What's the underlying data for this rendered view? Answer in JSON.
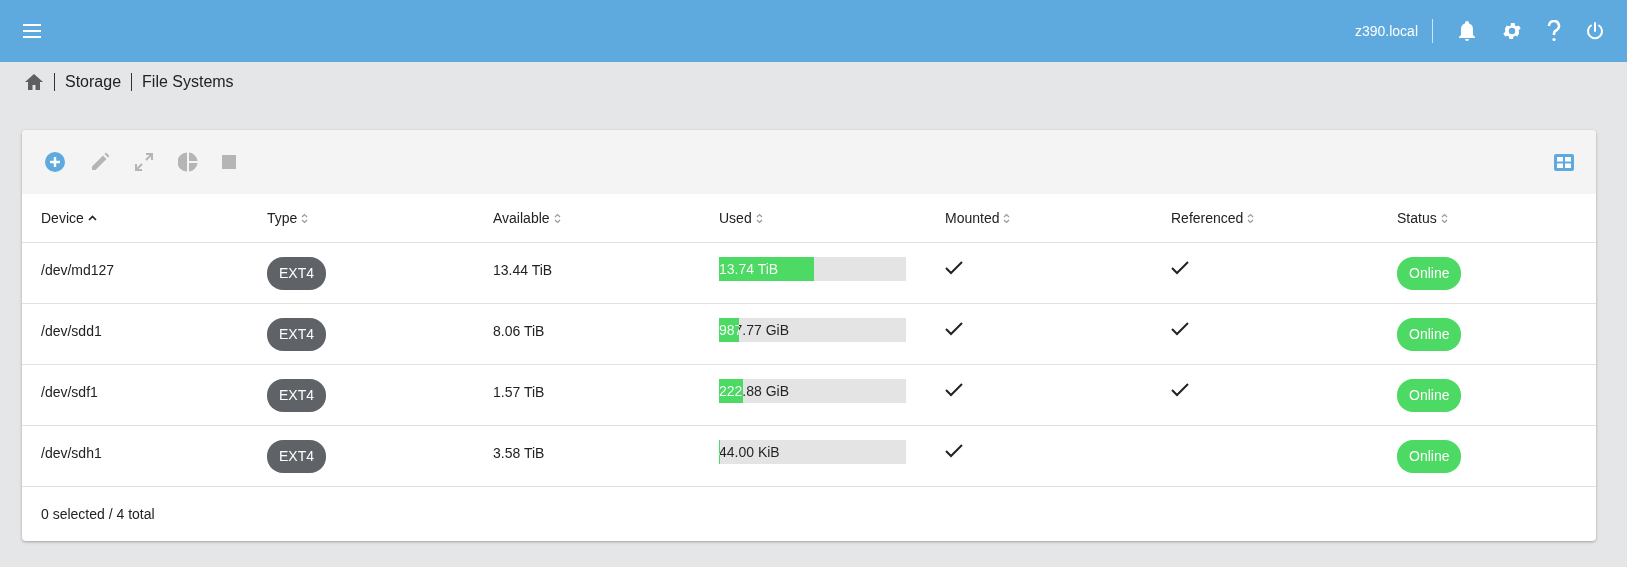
{
  "topbar": {
    "hostname": "z390.local"
  },
  "breadcrumb": [
    "Storage",
    "File Systems"
  ],
  "toolbar": [
    {
      "kind": "add",
      "disabled": false
    },
    {
      "kind": "edit",
      "disabled": true
    },
    {
      "kind": "resize",
      "disabled": true
    },
    {
      "kind": "quota",
      "disabled": true
    },
    {
      "kind": "stop",
      "disabled": true
    }
  ],
  "table": {
    "columns": [
      {
        "label": "Device",
        "sorted": true
      },
      {
        "label": "Type",
        "sorted": false
      },
      {
        "label": "Available",
        "sorted": false
      },
      {
        "label": "Used",
        "sorted": false
      },
      {
        "label": "Mounted",
        "sorted": false
      },
      {
        "label": "Referenced",
        "sorted": false
      },
      {
        "label": "Status",
        "sorted": false
      }
    ],
    "rows": [
      {
        "device": "/dev/md127",
        "type": "EXT4",
        "available": "13.44 TiB",
        "used": "13.74 TiB",
        "level": 0.51,
        "mounted": true,
        "referenced": true,
        "status": "Online"
      },
      {
        "device": "/dev/sdd1",
        "type": "EXT4",
        "available": "8.06 TiB",
        "used": "987.77 GiB",
        "level": 0.105,
        "mounted": true,
        "referenced": true,
        "status": "Online"
      },
      {
        "device": "/dev/sdf1",
        "type": "EXT4",
        "available": "1.57 TiB",
        "used": "222.88 GiB",
        "level": 0.13,
        "mounted": true,
        "referenced": true,
        "status": "Online"
      },
      {
        "device": "/dev/sdh1",
        "type": "EXT4",
        "available": "3.58 TiB",
        "used": "44.00 KiB",
        "level": 0.006,
        "mounted": true,
        "referenced": false,
        "status": "Online"
      }
    ]
  },
  "footer": "0 selected / 4 total"
}
